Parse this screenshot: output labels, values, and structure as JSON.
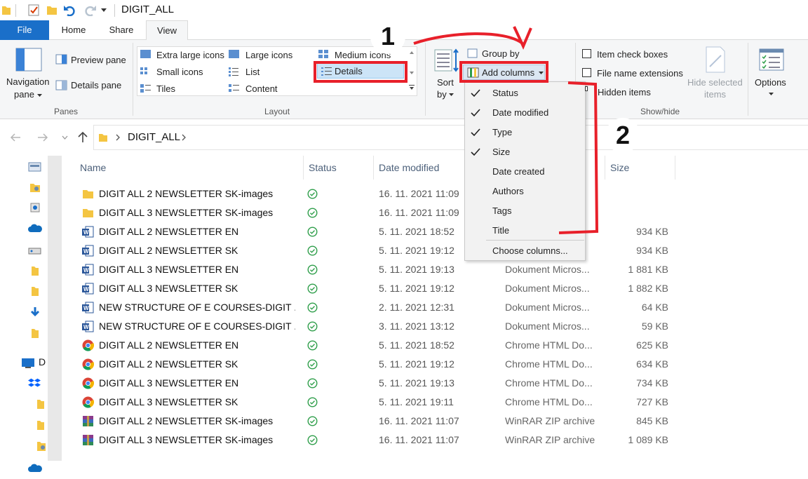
{
  "window": {
    "title": "DIGIT_ALL"
  },
  "tabs": [
    {
      "label": "File"
    },
    {
      "label": "Home"
    },
    {
      "label": "Share"
    },
    {
      "label": "View"
    }
  ],
  "ribbon": {
    "panes": {
      "navigation_pane": "Navigation",
      "navigation_pane_2": "pane",
      "preview_pane": "Preview pane",
      "details_pane": "Details pane",
      "group_label": "Panes"
    },
    "layout": {
      "extra_large_icons": "Extra large icons",
      "large_icons": "Large icons",
      "medium_icons": "Medium icons",
      "small_icons": "Small icons",
      "list": "List",
      "details": "Details",
      "tiles": "Tiles",
      "content": "Content",
      "group_label": "Layout"
    },
    "current_view": {
      "sort_by": "Sort",
      "sort_by_2": "by",
      "group_by": "Group by",
      "add_columns": "Add columns"
    },
    "show_hide": {
      "item_check_boxes": "Item check boxes",
      "file_name_extensions": "File name extensions",
      "hidden_items": "Hidden items",
      "hide_selected_items": "Hide selected",
      "hide_selected_items_2": "items",
      "group_label": "Show/hide"
    },
    "options": "Options"
  },
  "address": {
    "crumb": "DIGIT_ALL"
  },
  "columns": {
    "name": "Name",
    "status": "Status",
    "date_modified": "Date modified",
    "size": "Size"
  },
  "files": [
    {
      "name": "DIGIT ALL  2 NEWSLETTER  SK-images",
      "date": "16. 11. 2021 11:09",
      "type": "",
      "size": "",
      "icon": "folder-icon"
    },
    {
      "name": "DIGIT ALL  3 NEWSLETTER  SK-images",
      "date": "16. 11. 2021 11:09",
      "type": "",
      "size": "",
      "icon": "folder-icon"
    },
    {
      "name": "DIGIT ALL  2 NEWSLETTER  EN",
      "date": "5. 11. 2021 18:52",
      "type": "",
      "size": "934 KB",
      "icon": "word-icon"
    },
    {
      "name": "DIGIT ALL  2 NEWSLETTER  SK",
      "date": "5. 11. 2021 19:12",
      "type": "",
      "size": "934 KB",
      "icon": "word-icon"
    },
    {
      "name": "DIGIT ALL  3 NEWSLETTER  EN",
      "date": "5. 11. 2021 19:13",
      "type": "Dokument Micros...",
      "size": "1 881 KB",
      "icon": "word-icon"
    },
    {
      "name": "DIGIT ALL  3 NEWSLETTER  SK",
      "date": "5. 11. 2021 19:12",
      "type": "Dokument Micros...",
      "size": "1 882 KB",
      "icon": "word-icon"
    },
    {
      "name": "NEW STRUCTURE OF E COURSES-DIGIT ...",
      "date": "2. 11. 2021 12:31",
      "type": "Dokument Micros...",
      "size": "64 KB",
      "icon": "word-icon"
    },
    {
      "name": "NEW STRUCTURE OF E COURSES-DIGIT ...",
      "date": "3. 11. 2021 13:12",
      "type": "Dokument Micros...",
      "size": "59 KB",
      "icon": "word-icon"
    },
    {
      "name": "DIGIT ALL  2 NEWSLETTER  EN",
      "date": "5. 11. 2021 18:52",
      "type": "Chrome HTML Do...",
      "size": "625 KB",
      "icon": "chrome-icon"
    },
    {
      "name": "DIGIT ALL  2 NEWSLETTER  SK",
      "date": "5. 11. 2021 19:12",
      "type": "Chrome HTML Do...",
      "size": "634 KB",
      "icon": "chrome-icon"
    },
    {
      "name": "DIGIT ALL  3 NEWSLETTER  EN",
      "date": "5. 11. 2021 19:13",
      "type": "Chrome HTML Do...",
      "size": "734 KB",
      "icon": "chrome-icon"
    },
    {
      "name": "DIGIT ALL  3 NEWSLETTER  SK",
      "date": "5. 11. 2021 19:11",
      "type": "Chrome HTML Do...",
      "size": "727 KB",
      "icon": "chrome-icon"
    },
    {
      "name": "DIGIT ALL  2 NEWSLETTER  SK-images",
      "date": "16. 11. 2021 11:07",
      "type": "WinRAR ZIP archive",
      "size": "845 KB",
      "icon": "winrar-icon"
    },
    {
      "name": "DIGIT ALL  3 NEWSLETTER  SK-images",
      "date": "16. 11. 2021 11:07",
      "type": "WinRAR ZIP archive",
      "size": "1 089 KB",
      "icon": "winrar-icon"
    }
  ],
  "add_columns_menu": {
    "items": [
      {
        "label": "Status",
        "checked": true
      },
      {
        "label": "Date modified",
        "checked": true
      },
      {
        "label": "Type",
        "checked": true
      },
      {
        "label": "Size",
        "checked": true
      },
      {
        "label": "Date created",
        "checked": false
      },
      {
        "label": "Authors",
        "checked": false
      },
      {
        "label": "Tags",
        "checked": false
      },
      {
        "label": "Title",
        "checked": false
      }
    ],
    "choose_columns": "Choose columns..."
  },
  "annotations": {
    "step1": "1",
    "step2": "2"
  },
  "left_pane": {
    "desktop_label": "D"
  },
  "colors": {
    "accent": "#1a6fc9",
    "annotation": "#e8202a",
    "status_ok": "#2e9e4a"
  }
}
